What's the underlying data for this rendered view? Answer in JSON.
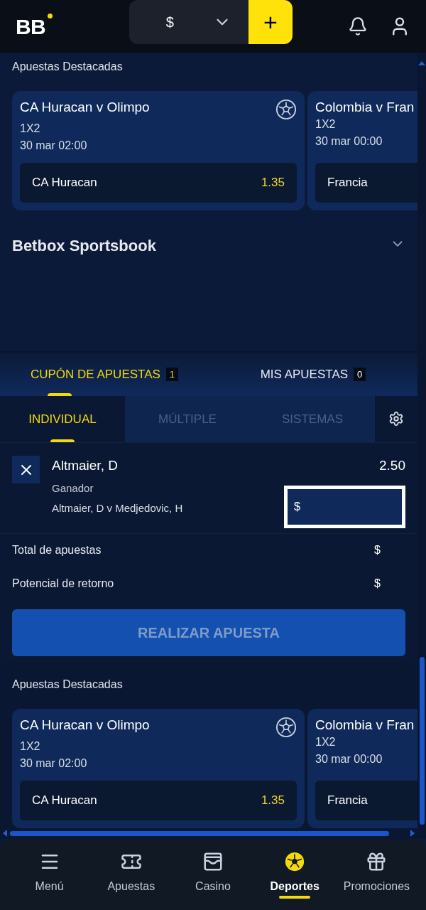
{
  "header": {
    "logo": "BB",
    "currency": "$",
    "add": "+"
  },
  "featured_top": {
    "title": "Apuestas Destacadas",
    "cards": [
      {
        "title": "CA Huracan v Olimpo",
        "market": "1X2",
        "time": "30 mar 02:00",
        "selection": "CA Huracan",
        "odds": "1.35",
        "sport_icon": true
      },
      {
        "title": "Colombia v Fran",
        "market": "1X2",
        "time": "30 mar 00:00",
        "selection": "Francia",
        "sport_icon": false
      }
    ]
  },
  "sportsbook": {
    "title": "Betbox Sportsbook",
    "expanded": false
  },
  "coupon_tabs": [
    {
      "label": "CUPÓN DE APUESTAS",
      "count": "1",
      "selected": true
    },
    {
      "label": "MIS APUESTAS",
      "count": "0",
      "selected": false
    }
  ],
  "bet_types": [
    {
      "label": "INDIVIDUAL",
      "selected": true
    },
    {
      "label": "MÚLTIPLE",
      "selected": false
    },
    {
      "label": "SISTEMAS",
      "selected": false
    }
  ],
  "bet": {
    "selection": "Altmaier, D",
    "odds": "2.50",
    "market": "Ganador",
    "match": "Altmaier, D v Medjedovic, H",
    "stake_prefix": "$"
  },
  "totals": [
    {
      "label": "Total de apuestas",
      "value": "$"
    },
    {
      "label": "Potencial de retorno",
      "value": "$"
    }
  ],
  "place_bet": {
    "label": "REALIZAR APUESTA",
    "disabled": true
  },
  "featured_bottom": {
    "title": "Apuestas Destacadas",
    "cards": [
      {
        "title": "CA Huracan v Olimpo",
        "market": "1X2",
        "time": "30 mar 02:00",
        "selection": "CA Huracan",
        "odds": "1.35",
        "sport_icon": true
      },
      {
        "title": "Colombia v Fran",
        "market": "1X2",
        "time": "30 mar 00:00",
        "selection": "Francia",
        "sport_icon": false
      }
    ]
  },
  "bottom_nav": [
    {
      "label": "Menú",
      "kind": "menu",
      "selected": false
    },
    {
      "label": "Apuestas",
      "kind": "ticket",
      "selected": false
    },
    {
      "label": "Casino",
      "kind": "cards",
      "selected": false
    },
    {
      "label": "Deportes",
      "kind": "ball",
      "selected": true
    },
    {
      "label": "Promociones",
      "kind": "gift",
      "selected": false
    }
  ]
}
